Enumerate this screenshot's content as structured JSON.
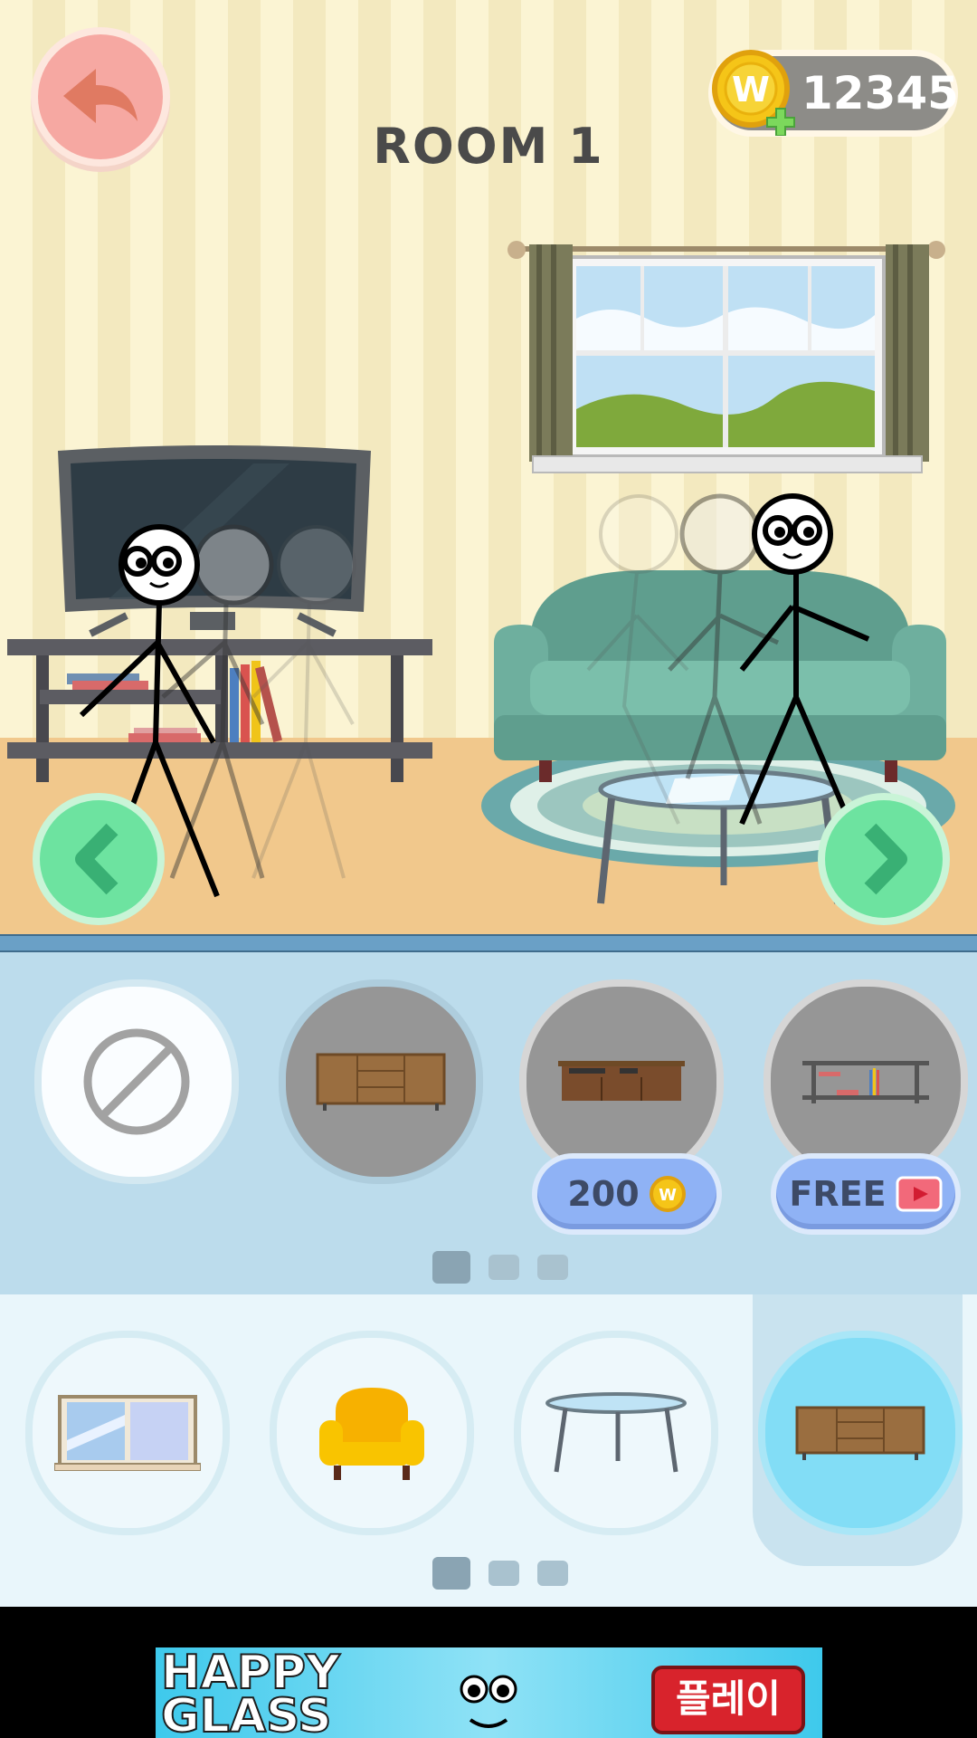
{
  "header": {
    "back_icon": "back-arrow-icon",
    "coin_balance": "12345",
    "room_title": "ROOM 1"
  },
  "scene": {
    "prev_icon": "chevron-left-icon",
    "next_icon": "chevron-right-icon"
  },
  "style_panel": {
    "items": [
      {
        "icon": "none-icon",
        "state": "selected"
      },
      {
        "icon": "sideboard-icon",
        "state": "owned"
      },
      {
        "icon": "tv-stand-icon",
        "price": "200",
        "state": "locked"
      },
      {
        "icon": "shelf-icon",
        "price": "FREE",
        "state": "ad"
      }
    ],
    "page": {
      "current": 1,
      "total": 3
    }
  },
  "category_panel": {
    "items": [
      {
        "icon": "window-icon"
      },
      {
        "icon": "armchair-icon"
      },
      {
        "icon": "coffee-table-icon"
      },
      {
        "icon": "cabinet-icon",
        "selected": true
      }
    ],
    "page": {
      "current": 1,
      "total": 3
    }
  },
  "ad": {
    "title_line1": "HAPPY",
    "title_line2": "GLASS",
    "play_label": "플레이"
  },
  "colors": {
    "coin": "#f5c518",
    "accent_green": "#6de3a0",
    "price_button": "#8fb2f5"
  }
}
